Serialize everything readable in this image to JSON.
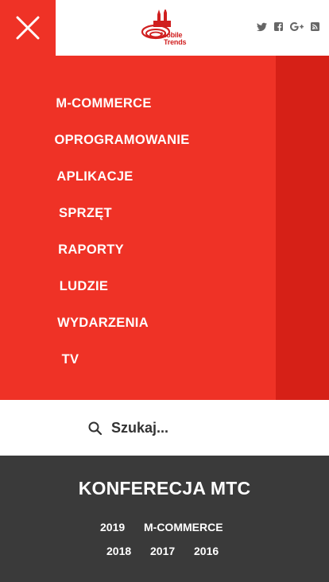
{
  "header": {
    "close_icon": "close-icon",
    "logo": {
      "line1": "Mobile",
      "line2": "Trends",
      "color": "#d01f1f"
    },
    "social_icons": [
      "twitter-icon",
      "facebook-icon",
      "google-plus-icon",
      "rss-icon"
    ]
  },
  "menu": {
    "items": [
      {
        "label": "M-COMMERCE"
      },
      {
        "label": "OPROGRAMOWANIE"
      },
      {
        "label": "APLIKACJE"
      },
      {
        "label": "SPRZĘT"
      },
      {
        "label": "RAPORTY"
      },
      {
        "label": "LUDZIE"
      },
      {
        "label": "WYDARZENIA"
      },
      {
        "label": "TV"
      }
    ]
  },
  "search": {
    "placeholder": "Szukaj..."
  },
  "footer": {
    "title": "KONFERECJA MTC",
    "links": [
      {
        "label": "2019"
      },
      {
        "label": "M-COMMERCE"
      },
      {
        "label": "2018"
      },
      {
        "label": "2017"
      },
      {
        "label": "2016"
      }
    ]
  },
  "colors": {
    "accent": "#ef3226",
    "accent_dark": "#d62017",
    "footer_bg": "#3a3a3a"
  }
}
